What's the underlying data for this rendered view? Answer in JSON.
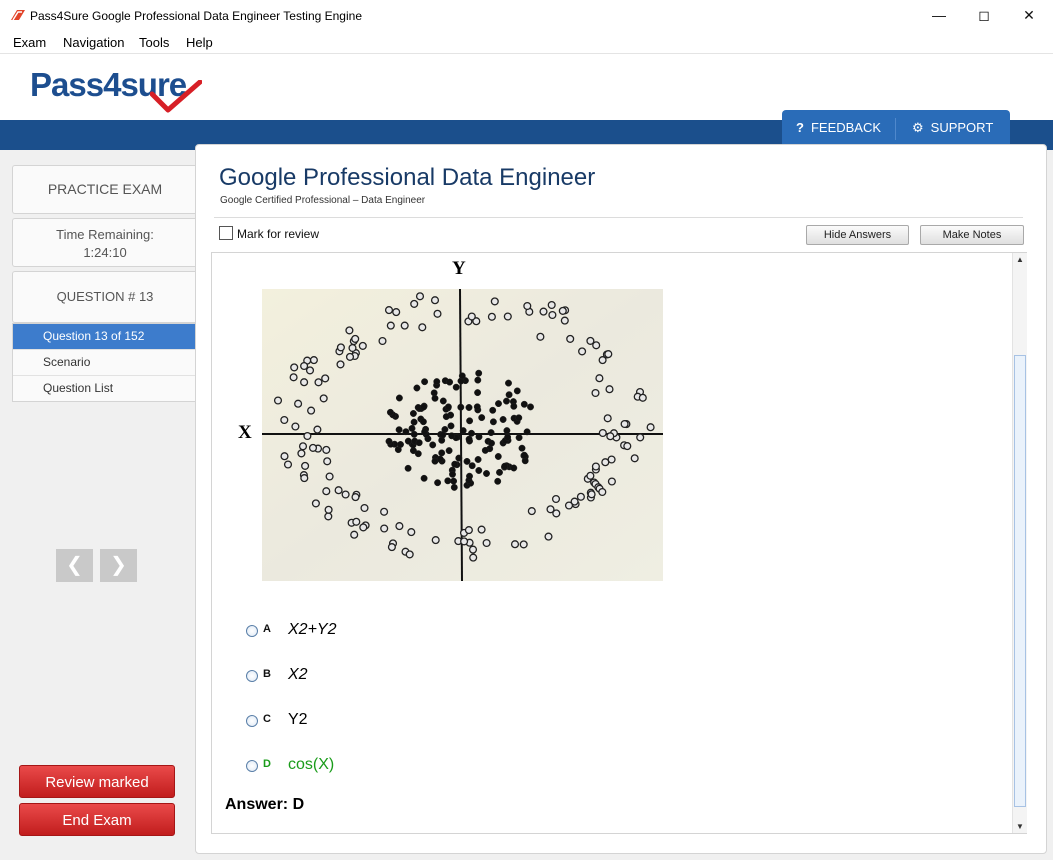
{
  "window": {
    "title": "Pass4Sure Google Professional Data Engineer Testing Engine"
  },
  "menu": [
    "Exam",
    "Navigation",
    "Tools",
    "Help"
  ],
  "logo": {
    "text_a": "Pass4",
    "text_b": "sure"
  },
  "header": {
    "feedback": "FEEDBACK",
    "support": "SUPPORT"
  },
  "sidebar": {
    "practice": "PRACTICE EXAM",
    "time_label": "Time Remaining:",
    "time_value": "1:24:10",
    "question_no": "QUESTION # 13",
    "items": [
      {
        "label": "Question 13 of 152",
        "active": true
      },
      {
        "label": "Scenario"
      },
      {
        "label": "Question List"
      }
    ],
    "review_marked": "Review marked",
    "end_exam": "End Exam"
  },
  "main": {
    "title": "Google Professional Data Engineer",
    "subtitle": "Google Certified Professional – Data Engineer",
    "mark_review": "Mark for review",
    "hide_answers": "Hide Answers",
    "make_notes": "Make Notes"
  },
  "figure": {
    "x_label": "X",
    "y_label": "Y"
  },
  "options": [
    {
      "letter": "A",
      "text": "X2+Y2",
      "color": "#000000"
    },
    {
      "letter": "B",
      "text": "X2",
      "color": "#000000"
    },
    {
      "letter": "C",
      "text": "Y2",
      "color": "#000000"
    },
    {
      "letter": "D",
      "text": "cos(X)",
      "color": "#1a9c1a"
    }
  ],
  "answer": "Answer: D",
  "colors": {
    "brand_blue": "#1b4f8c",
    "accent_blue": "#2a6cb8",
    "red": "#d32f2f",
    "correct_green": "#1a9c1a"
  }
}
